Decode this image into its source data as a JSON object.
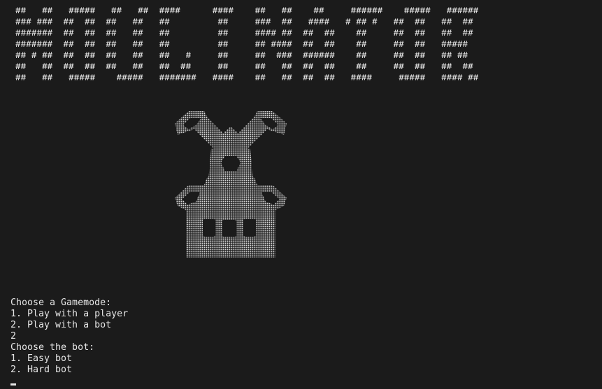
{
  "banner": {
    "lines": [
      "##   ##   #####   ##   ##  ####      ####    ##   ##    ##     ######    #####   ######",
      "### ###  ##  ##  ##   ##   ##         ##     ###  ##   ####   # ## #   ##  ##   ##  ##",
      "#######  ##  ##  ##   ##   ##         ##     #### ##  ##  ##    ##     ##  ##   ##  ##",
      "#######  ##  ##  ##   ##   ##         ##     ## ####  ##  ##    ##     ##  ##   #####",
      "## # ##  ##  ##  ##   ##   ##   #     ##     ##  ###  ######    ##     ##  ##   ## ##",
      "##   ##  ##  ##  ##   ##   ##  ##     ##     ##   ##  ##  ##    ##     ##  ##   ##  ##",
      "##   ##   #####    #####   #######   ####    ##   ##  ##  ##   ####     #####   #### ##"
    ]
  },
  "windmill": {
    "icon": "windmill-ascii-art",
    "dot_color": "#d8d8d8"
  },
  "console": {
    "gamemode_prompt": "Choose a Gamemode:",
    "gamemode_option_1": "1. Play with a player",
    "gamemode_option_2": "2. Play with a bot",
    "gamemode_input": "2",
    "bot_prompt": "Choose the bot:",
    "bot_option_1": "1. Easy bot",
    "bot_option_2": "2. Hard bot"
  },
  "colors": {
    "background": "#1b1b1b",
    "text": "#e6e6e6"
  }
}
